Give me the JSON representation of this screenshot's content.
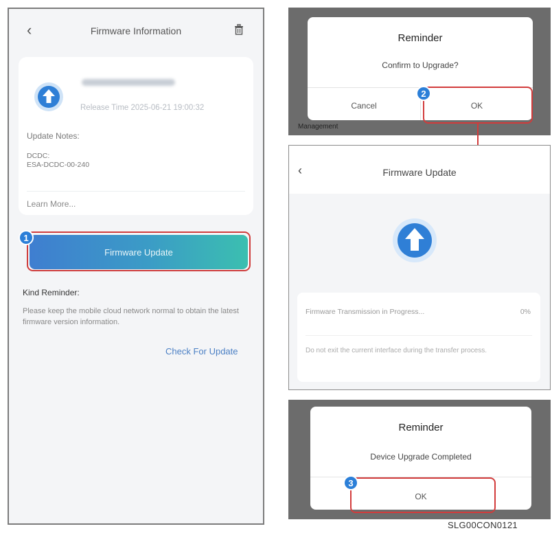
{
  "left_screen": {
    "title": "Firmware Information",
    "back_icon": "chevron-left-icon",
    "trash_icon": "trash-icon",
    "release_time": "Release Time 2025-06-21 19:00:32",
    "update_notes_label": "Update Notes:",
    "update_notes_line1": "DCDC:",
    "update_notes_line2": "ESA-DCDC-00-240",
    "learn_more": "Learn More...",
    "firmware_update_button": "Firmware Update",
    "kind_reminder_title": "Kind Reminder:",
    "kind_reminder_text": "Please keep the mobile cloud network normal to obtain the latest firmware version information.",
    "check_for_update": "Check For Update"
  },
  "confirm_dialog": {
    "title": "Reminder",
    "message": "Confirm to Upgrade?",
    "cancel": "Cancel",
    "ok": "OK",
    "background_text": "Management"
  },
  "update_screen": {
    "title": "Firmware Update",
    "back_icon": "chevron-left-icon",
    "progress_label": "Firmware Transmission in Progress...",
    "progress_percent": "0%",
    "progress_value": 0,
    "note": "Do not exit the current interface during the transfer process."
  },
  "complete_dialog": {
    "title": "Reminder",
    "message": "Device Upgrade Completed",
    "ok": "OK"
  },
  "steps": {
    "one": "1",
    "two": "2",
    "three": "3"
  },
  "figure_id": "SLG00CON0121",
  "colors": {
    "accent_blue": "#2b7fd8",
    "highlight_red": "#d23b3b",
    "button_gradient_start": "#3f7ed0",
    "button_gradient_end": "#3bbfb0",
    "link_blue": "#4a7fc4"
  }
}
